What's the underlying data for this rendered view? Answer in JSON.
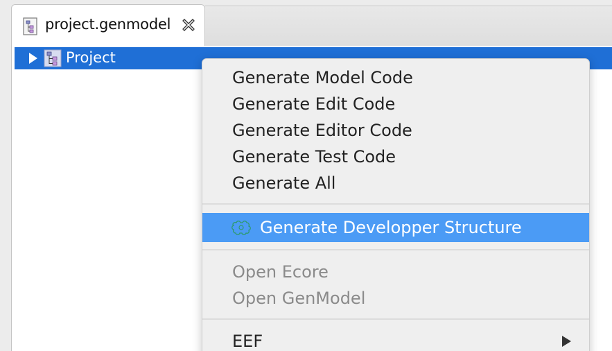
{
  "editor_tab": {
    "label": "project.genmodel",
    "icon": "genmodel-file-icon",
    "close_icon": "close-icon"
  },
  "tree": {
    "root": {
      "label": "Project",
      "icon": "genmodel-icon",
      "expander": "expand-arrow-icon",
      "selected": true
    }
  },
  "context_menu": {
    "groups": [
      {
        "items": [
          {
            "label": "Generate Model Code",
            "enabled": true
          },
          {
            "label": "Generate Edit Code",
            "enabled": true
          },
          {
            "label": "Generate Editor Code",
            "enabled": true
          },
          {
            "label": "Generate Test Code",
            "enabled": true
          },
          {
            "label": "Generate All",
            "enabled": true
          }
        ]
      },
      {
        "items": [
          {
            "label": "Generate Developper Structure",
            "enabled": true,
            "highlighted": true,
            "icon": "puzzle-icon"
          }
        ]
      },
      {
        "items": [
          {
            "label": "Open Ecore",
            "enabled": false
          },
          {
            "label": "Open GenModel",
            "enabled": false
          }
        ]
      },
      {
        "items": [
          {
            "label": "EEF",
            "enabled": true,
            "submenu": true
          }
        ]
      }
    ]
  },
  "colors": {
    "selection": "#1f6fd6",
    "menu_highlight": "#4b9bf5",
    "menu_background": "#efefef",
    "disabled_text": "#8a8a8a"
  }
}
